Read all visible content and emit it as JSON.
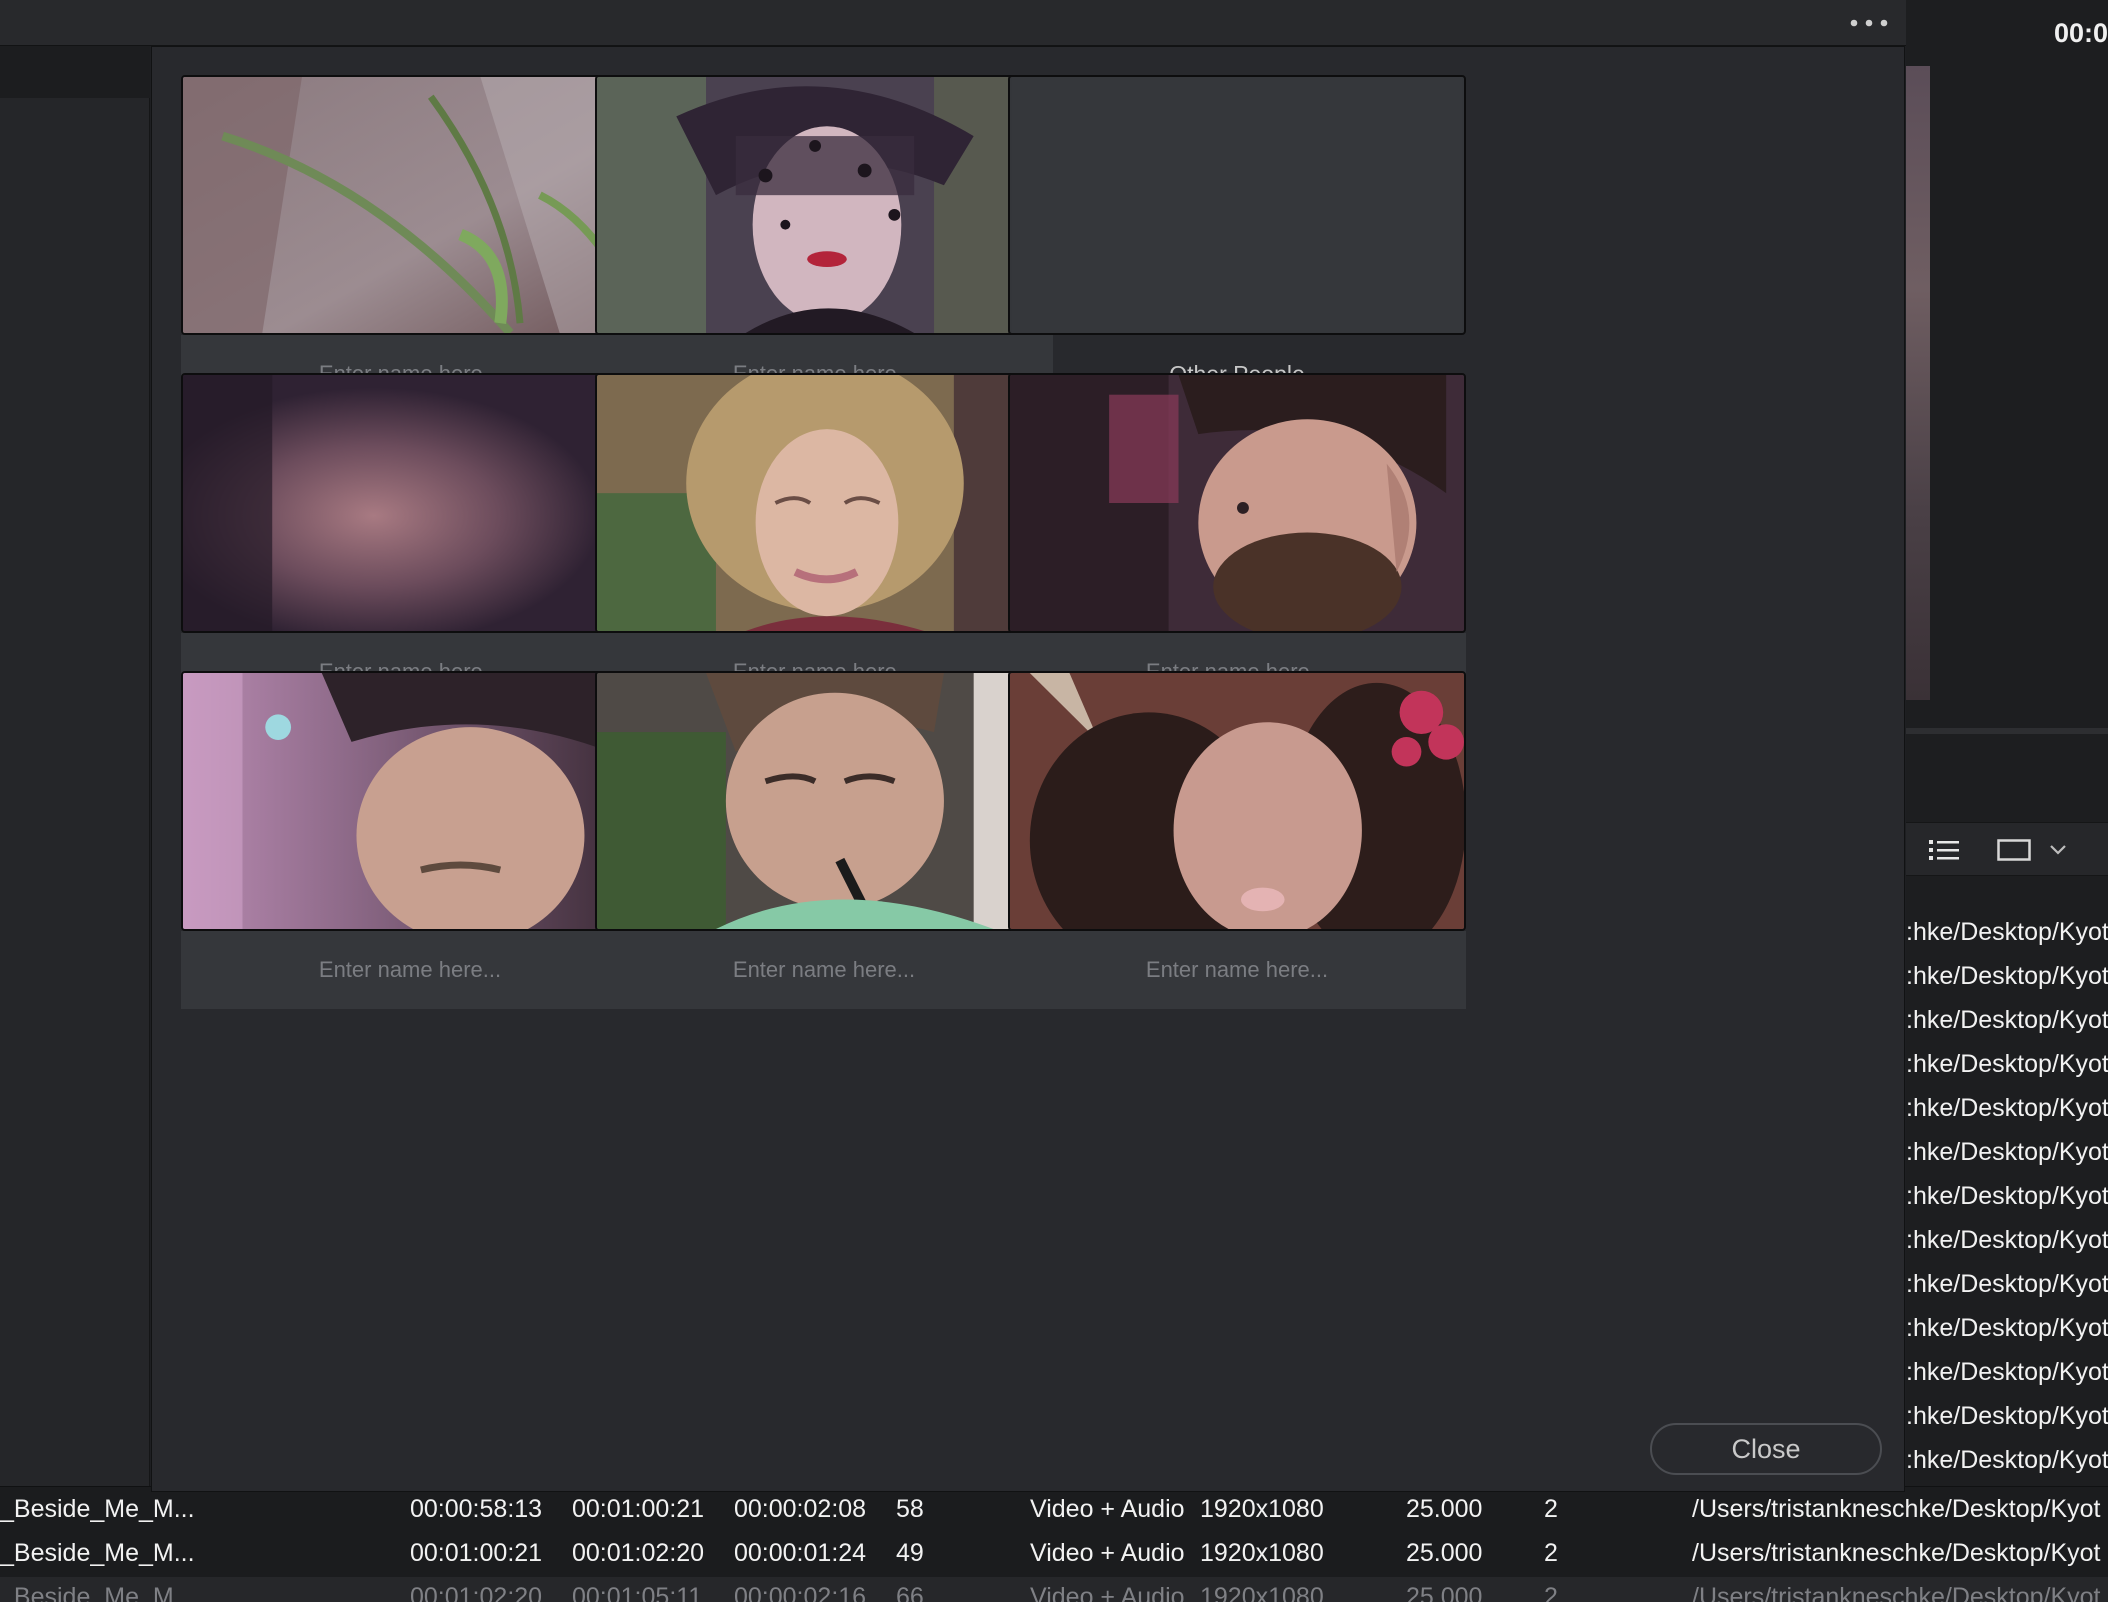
{
  "app": {
    "timecode": "00:0",
    "more_icon": "more-horizontal-icon"
  },
  "dialog": {
    "name_placeholder": "Enter name here...",
    "other_people_label": "Other People",
    "close_label": "Close",
    "cards": [
      {
        "kind": "input",
        "thumbnail": "foliage-closeup"
      },
      {
        "kind": "input",
        "thumbnail": "woman-veiled-hat"
      },
      {
        "kind": "label",
        "thumbnail": "empty"
      },
      {
        "kind": "input",
        "thumbnail": "blurred-face"
      },
      {
        "kind": "input",
        "thumbnail": "woman-curly-hair"
      },
      {
        "kind": "input",
        "thumbnail": "man-beard-profile"
      },
      {
        "kind": "input",
        "thumbnail": "man-blurred-cap"
      },
      {
        "kind": "input",
        "thumbnail": "man-pipe"
      },
      {
        "kind": "input",
        "thumbnail": "man-long-hair-flowers"
      }
    ]
  },
  "right_panel": {
    "path_fragments": [
      "hke/Desktop/Kyot",
      "hke/Desktop/Kyot",
      "hke/Desktop/Kyot",
      "hke/Desktop/Kyot",
      "hke/Desktop/Kyot",
      "hke/Desktop/Kyot",
      "hke/Desktop/Kyot",
      "hke/Desktop/Kyot",
      "hke/Desktop/Kyot",
      "hke/Desktop/Kyot",
      "hke/Desktop/Kyot",
      "hke/Desktop/Kyot",
      "hke/Desktop/Kyot"
    ],
    "toolbar_icons": [
      "list-view-icon",
      "frame-view-icon",
      "chevron-down-icon"
    ]
  },
  "table_rows": [
    {
      "name": "_Beside_Me_M...",
      "start": "00:00:58:13",
      "end": "00:01:00:21",
      "duration": "00:00:02:08",
      "frames": "58",
      "type": "Video + Audio",
      "resolution": "1920x1080",
      "fps": "25.000",
      "channels": "2",
      "path": "/Users/tristankneschke/Desktop/Kyot"
    },
    {
      "name": "_Beside_Me_M...",
      "start": "00:01:00:21",
      "end": "00:01:02:20",
      "duration": "00:00:01:24",
      "frames": "49",
      "type": "Video + Audio",
      "resolution": "1920x1080",
      "fps": "25.000",
      "channels": "2",
      "path": "/Users/tristankneschke/Desktop/Kyot"
    },
    {
      "name": "_Beside_Me_M...",
      "start": "00:01:02:20",
      "end": "00:01:05:11",
      "duration": "00:00:02:16",
      "frames": "66",
      "type": "Video + Audio",
      "resolution": "1920x1080",
      "fps": "25.000",
      "channels": "2",
      "path": "/Users/tristankneschke/Desktop/Kyot"
    }
  ]
}
